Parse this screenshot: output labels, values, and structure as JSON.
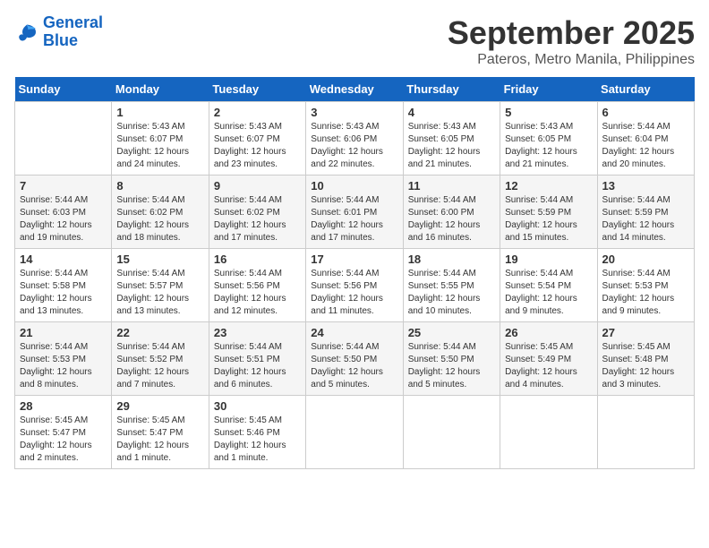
{
  "header": {
    "logo_line1": "General",
    "logo_line2": "Blue",
    "month": "September 2025",
    "location": "Pateros, Metro Manila, Philippines"
  },
  "days_of_week": [
    "Sunday",
    "Monday",
    "Tuesday",
    "Wednesday",
    "Thursday",
    "Friday",
    "Saturday"
  ],
  "weeks": [
    [
      {
        "num": "",
        "info": ""
      },
      {
        "num": "1",
        "info": "Sunrise: 5:43 AM\nSunset: 6:07 PM\nDaylight: 12 hours\nand 24 minutes."
      },
      {
        "num": "2",
        "info": "Sunrise: 5:43 AM\nSunset: 6:07 PM\nDaylight: 12 hours\nand 23 minutes."
      },
      {
        "num": "3",
        "info": "Sunrise: 5:43 AM\nSunset: 6:06 PM\nDaylight: 12 hours\nand 22 minutes."
      },
      {
        "num": "4",
        "info": "Sunrise: 5:43 AM\nSunset: 6:05 PM\nDaylight: 12 hours\nand 21 minutes."
      },
      {
        "num": "5",
        "info": "Sunrise: 5:43 AM\nSunset: 6:05 PM\nDaylight: 12 hours\nand 21 minutes."
      },
      {
        "num": "6",
        "info": "Sunrise: 5:44 AM\nSunset: 6:04 PM\nDaylight: 12 hours\nand 20 minutes."
      }
    ],
    [
      {
        "num": "7",
        "info": "Sunrise: 5:44 AM\nSunset: 6:03 PM\nDaylight: 12 hours\nand 19 minutes."
      },
      {
        "num": "8",
        "info": "Sunrise: 5:44 AM\nSunset: 6:02 PM\nDaylight: 12 hours\nand 18 minutes."
      },
      {
        "num": "9",
        "info": "Sunrise: 5:44 AM\nSunset: 6:02 PM\nDaylight: 12 hours\nand 17 minutes."
      },
      {
        "num": "10",
        "info": "Sunrise: 5:44 AM\nSunset: 6:01 PM\nDaylight: 12 hours\nand 17 minutes."
      },
      {
        "num": "11",
        "info": "Sunrise: 5:44 AM\nSunset: 6:00 PM\nDaylight: 12 hours\nand 16 minutes."
      },
      {
        "num": "12",
        "info": "Sunrise: 5:44 AM\nSunset: 5:59 PM\nDaylight: 12 hours\nand 15 minutes."
      },
      {
        "num": "13",
        "info": "Sunrise: 5:44 AM\nSunset: 5:59 PM\nDaylight: 12 hours\nand 14 minutes."
      }
    ],
    [
      {
        "num": "14",
        "info": "Sunrise: 5:44 AM\nSunset: 5:58 PM\nDaylight: 12 hours\nand 13 minutes."
      },
      {
        "num": "15",
        "info": "Sunrise: 5:44 AM\nSunset: 5:57 PM\nDaylight: 12 hours\nand 13 minutes."
      },
      {
        "num": "16",
        "info": "Sunrise: 5:44 AM\nSunset: 5:56 PM\nDaylight: 12 hours\nand 12 minutes."
      },
      {
        "num": "17",
        "info": "Sunrise: 5:44 AM\nSunset: 5:56 PM\nDaylight: 12 hours\nand 11 minutes."
      },
      {
        "num": "18",
        "info": "Sunrise: 5:44 AM\nSunset: 5:55 PM\nDaylight: 12 hours\nand 10 minutes."
      },
      {
        "num": "19",
        "info": "Sunrise: 5:44 AM\nSunset: 5:54 PM\nDaylight: 12 hours\nand 9 minutes."
      },
      {
        "num": "20",
        "info": "Sunrise: 5:44 AM\nSunset: 5:53 PM\nDaylight: 12 hours\nand 9 minutes."
      }
    ],
    [
      {
        "num": "21",
        "info": "Sunrise: 5:44 AM\nSunset: 5:53 PM\nDaylight: 12 hours\nand 8 minutes."
      },
      {
        "num": "22",
        "info": "Sunrise: 5:44 AM\nSunset: 5:52 PM\nDaylight: 12 hours\nand 7 minutes."
      },
      {
        "num": "23",
        "info": "Sunrise: 5:44 AM\nSunset: 5:51 PM\nDaylight: 12 hours\nand 6 minutes."
      },
      {
        "num": "24",
        "info": "Sunrise: 5:44 AM\nSunset: 5:50 PM\nDaylight: 12 hours\nand 5 minutes."
      },
      {
        "num": "25",
        "info": "Sunrise: 5:44 AM\nSunset: 5:50 PM\nDaylight: 12 hours\nand 5 minutes."
      },
      {
        "num": "26",
        "info": "Sunrise: 5:45 AM\nSunset: 5:49 PM\nDaylight: 12 hours\nand 4 minutes."
      },
      {
        "num": "27",
        "info": "Sunrise: 5:45 AM\nSunset: 5:48 PM\nDaylight: 12 hours\nand 3 minutes."
      }
    ],
    [
      {
        "num": "28",
        "info": "Sunrise: 5:45 AM\nSunset: 5:47 PM\nDaylight: 12 hours\nand 2 minutes."
      },
      {
        "num": "29",
        "info": "Sunrise: 5:45 AM\nSunset: 5:47 PM\nDaylight: 12 hours\nand 1 minute."
      },
      {
        "num": "30",
        "info": "Sunrise: 5:45 AM\nSunset: 5:46 PM\nDaylight: 12 hours\nand 1 minute."
      },
      {
        "num": "",
        "info": ""
      },
      {
        "num": "",
        "info": ""
      },
      {
        "num": "",
        "info": ""
      },
      {
        "num": "",
        "info": ""
      }
    ]
  ]
}
